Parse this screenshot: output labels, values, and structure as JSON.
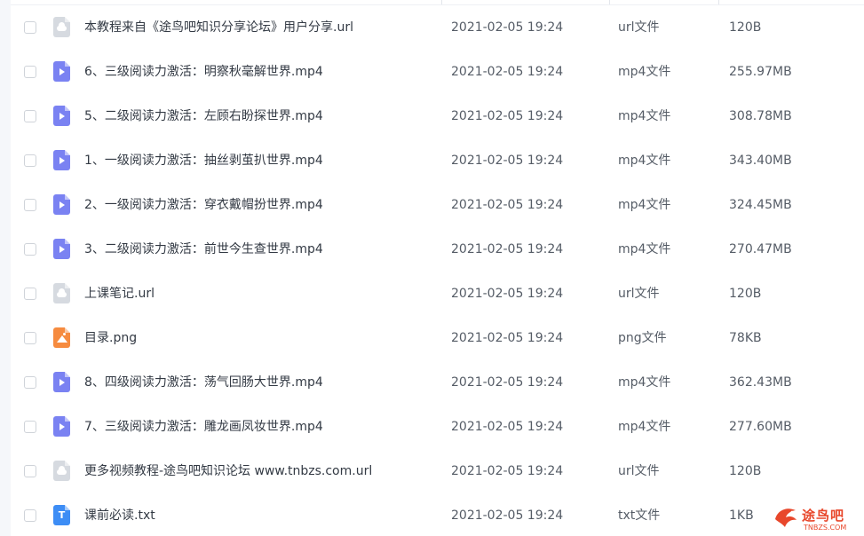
{
  "files": [
    {
      "icon": "link-file-icon",
      "kind": "link",
      "name": "本教程来自《途鸟吧知识分享论坛》用户分享.url",
      "date": "2021-02-05 19:24",
      "type": "url文件",
      "size": "120B"
    },
    {
      "icon": "video-file-icon",
      "kind": "video",
      "name": "6、三级阅读力激活：明察秋毫解世界.mp4",
      "date": "2021-02-05 19:24",
      "type": "mp4文件",
      "size": "255.97MB"
    },
    {
      "icon": "video-file-icon",
      "kind": "video",
      "name": "5、二级阅读力激活：左顾右盼探世界.mp4",
      "date": "2021-02-05 19:24",
      "type": "mp4文件",
      "size": "308.78MB"
    },
    {
      "icon": "video-file-icon",
      "kind": "video",
      "name": "1、一级阅读力激活：抽丝剥茧扒世界.mp4",
      "date": "2021-02-05 19:24",
      "type": "mp4文件",
      "size": "343.40MB"
    },
    {
      "icon": "video-file-icon",
      "kind": "video",
      "name": "2、一级阅读力激活：穿衣戴帽扮世界.mp4",
      "date": "2021-02-05 19:24",
      "type": "mp4文件",
      "size": "324.45MB"
    },
    {
      "icon": "video-file-icon",
      "kind": "video",
      "name": "3、二级阅读力激活：前世今生查世界.mp4",
      "date": "2021-02-05 19:24",
      "type": "mp4文件",
      "size": "270.47MB"
    },
    {
      "icon": "link-file-icon",
      "kind": "link",
      "name": "上课笔记.url",
      "date": "2021-02-05 19:24",
      "type": "url文件",
      "size": "120B"
    },
    {
      "icon": "image-file-icon",
      "kind": "image",
      "name": "目录.png",
      "date": "2021-02-05 19:24",
      "type": "png文件",
      "size": "78KB"
    },
    {
      "icon": "video-file-icon",
      "kind": "video",
      "name": "8、四级阅读力激活：荡气回肠大世界.mp4",
      "date": "2021-02-05 19:24",
      "type": "mp4文件",
      "size": "362.43MB"
    },
    {
      "icon": "video-file-icon",
      "kind": "video",
      "name": "7、三级阅读力激活：雕龙画凤妆世界.mp4",
      "date": "2021-02-05 19:24",
      "type": "mp4文件",
      "size": "277.60MB"
    },
    {
      "icon": "link-file-icon",
      "kind": "link",
      "name": "更多视频教程-途鸟吧知识论坛 www.tnbzs.com.url",
      "date": "2021-02-05 19:24",
      "type": "url文件",
      "size": "120B"
    },
    {
      "icon": "text-file-icon",
      "kind": "text",
      "name": "课前必读.txt",
      "date": "2021-02-05 19:24",
      "type": "txt文件",
      "size": "1KB",
      "glyph": "T"
    }
  ],
  "watermark": {
    "title": "途鸟吧",
    "subtitle": "TNBZS.COM",
    "color": "#e8472b"
  },
  "colors": {
    "video_icon": "#7a82f2",
    "link_icon": "#d6dae0",
    "image_icon": "#f68b3f",
    "text_icon": "#3d8df5"
  }
}
